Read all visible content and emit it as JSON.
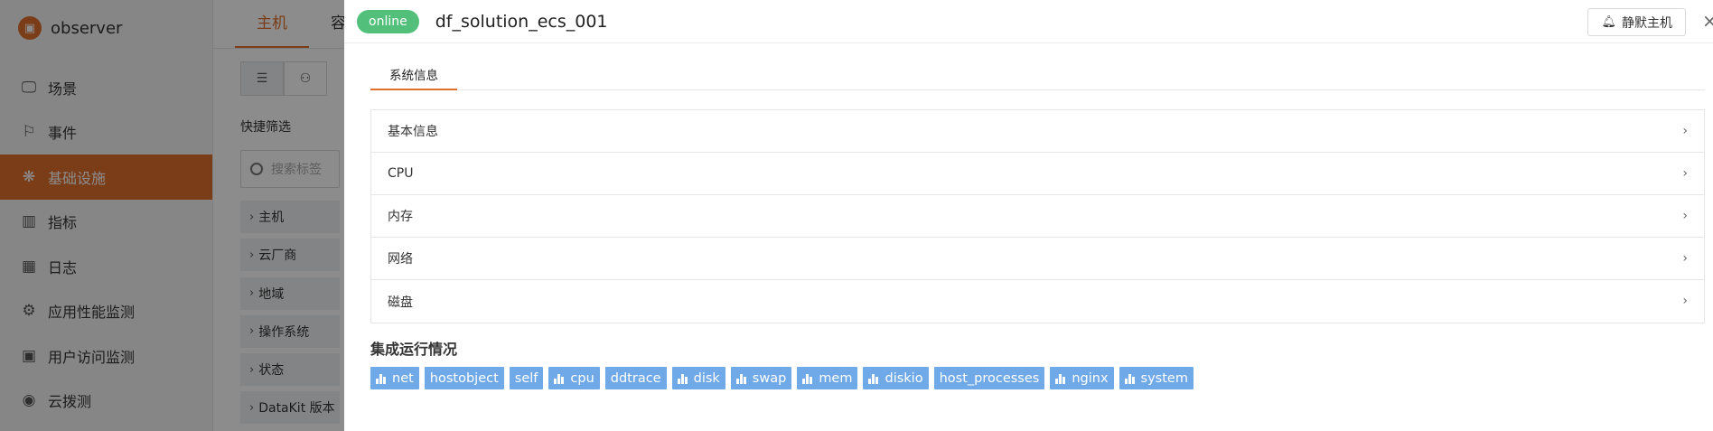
{
  "app": {
    "name": "observer"
  },
  "sidebar": {
    "items": [
      {
        "label": "场景",
        "icon": "monitor-icon"
      },
      {
        "label": "事件",
        "icon": "flag-icon"
      },
      {
        "label": "基础设施",
        "icon": "infrastructure-icon",
        "active": true
      },
      {
        "label": "指标",
        "icon": "bar-chart-icon"
      },
      {
        "label": "日志",
        "icon": "calendar-icon"
      },
      {
        "label": "应用性能监测",
        "icon": "apm-icon"
      },
      {
        "label": "用户访问监测",
        "icon": "user-monitor-icon"
      },
      {
        "label": "云拨测",
        "icon": "broadcast-icon"
      }
    ]
  },
  "middle": {
    "tabs": [
      {
        "label": "主机",
        "active": true
      },
      {
        "label": "容"
      }
    ],
    "quick_filter_label": "快捷筛选",
    "search_placeholder": "搜索标签",
    "filters": [
      "主机",
      "云厂商",
      "地域",
      "操作系统",
      "状态",
      "DataKit 版本"
    ]
  },
  "drawer": {
    "status": "online",
    "title": "df_solution_ecs_001",
    "mute_label": "静默主机",
    "close_label": "×",
    "tab": "系统信息",
    "sections": [
      "基本信息",
      "CPU",
      "内存",
      "网络",
      "磁盘"
    ],
    "integrations_title": "集成运行情况",
    "integrations": [
      {
        "label": "net",
        "has_icon": true
      },
      {
        "label": "hostobject",
        "has_icon": false
      },
      {
        "label": "self",
        "has_icon": false
      },
      {
        "label": "cpu",
        "has_icon": true
      },
      {
        "label": "ddtrace",
        "has_icon": false
      },
      {
        "label": "disk",
        "has_icon": true
      },
      {
        "label": "swap",
        "has_icon": true
      },
      {
        "label": "mem",
        "has_icon": true
      },
      {
        "label": "diskio",
        "has_icon": true
      },
      {
        "label": "host_processes",
        "has_icon": false
      },
      {
        "label": "nginx",
        "has_icon": true
      },
      {
        "label": "system",
        "has_icon": true
      }
    ]
  },
  "colors": {
    "accent": "#e06f2c",
    "online": "#52c07a",
    "badge": "#6fa9e8"
  }
}
